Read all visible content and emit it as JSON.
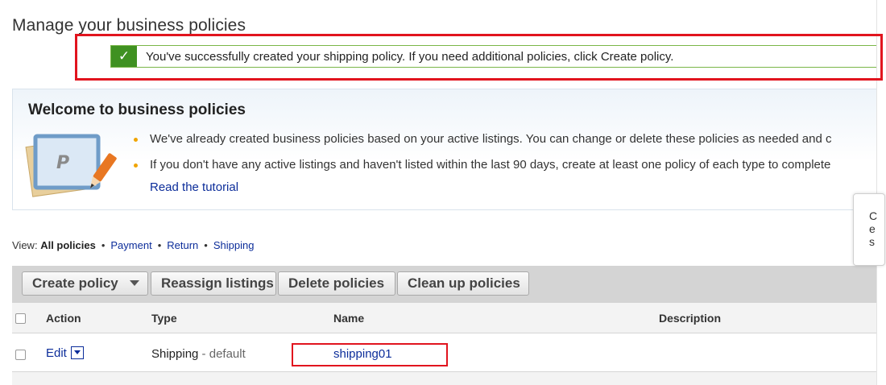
{
  "page": {
    "title": "Manage your business policies"
  },
  "success": {
    "check": "✓",
    "message": "You've successfully created your shipping policy. If you need additional policies, click Create policy."
  },
  "welcome": {
    "title": "Welcome to business policies",
    "bullets": [
      "We've already created business policies based on your active listings. You can change or delete these policies as needed and c",
      "If you don't have any active listings and haven't listed within the last 90 days, create at least one policy of each type to complete"
    ],
    "tutorial_link": "Read the tutorial",
    "illustration_letter": "P"
  },
  "view": {
    "label": "View:",
    "options": [
      "All policies",
      "Payment",
      "Return",
      "Shipping"
    ],
    "selected": "All policies"
  },
  "toolbar": {
    "create": "Create policy",
    "reassign": "Reassign listings",
    "delete": "Delete policies",
    "cleanup": "Clean up policies"
  },
  "table": {
    "columns": [
      "Action",
      "Type",
      "Name",
      "Description"
    ],
    "rows": [
      {
        "action": "Edit",
        "type": "Shipping",
        "type_suffix": " - default",
        "name": "shipping01",
        "description": ""
      }
    ]
  },
  "popup": {
    "lines": [
      "C",
      "e",
      "s"
    ]
  },
  "colors": {
    "link": "#0c2d9a",
    "success": "#3f9121",
    "highlight": "#e1141e",
    "bullet": "#f0a400"
  }
}
